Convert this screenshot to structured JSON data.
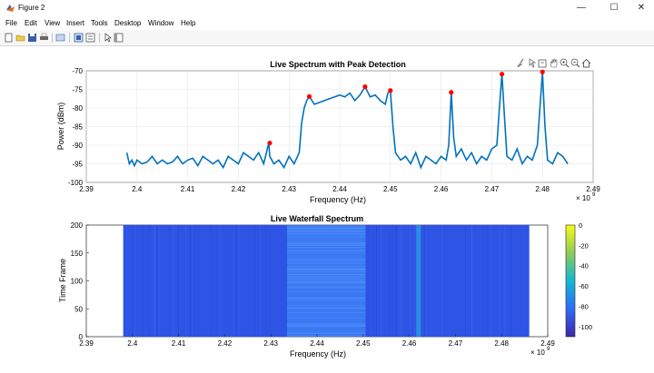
{
  "window": {
    "title": "Figure 2",
    "minimize": "—",
    "maximize": "☐",
    "close": "✕"
  },
  "menu": [
    "File",
    "Edit",
    "View",
    "Insert",
    "Tools",
    "Desktop",
    "Window",
    "Help"
  ],
  "toolbar_icons": [
    "new-figure-icon",
    "open-file-icon",
    "save-icon",
    "print-icon",
    "link-plot-icon",
    "dock-figure-icon",
    "property-inspector-icon",
    "edit-plot-arrow-icon",
    "plot-browser-icon"
  ],
  "axes_toolbar_icons": [
    "brush-icon",
    "data-tips-icon",
    "export-icon",
    "pan-hand-icon",
    "zoom-in-icon",
    "zoom-out-icon",
    "restore-view-icon"
  ],
  "colors": {
    "line": "#0072bd",
    "peak": "#ff0000",
    "grid": "#e6e6e6"
  },
  "chart_data": [
    {
      "type": "line",
      "title": "Live Spectrum with Peak Detection",
      "xlabel": "Frequency (Hz)",
      "ylabel": "Power (dBm)",
      "x_exponent": "× 10",
      "x_exponent_power": "9",
      "xlim": [
        2.39,
        2.49
      ],
      "ylim": [
        -100,
        -70
      ],
      "xticks": [
        "2.39",
        "2.4",
        "2.41",
        "2.42",
        "2.43",
        "2.44",
        "2.45",
        "2.46",
        "2.47",
        "2.48",
        "2.49"
      ],
      "yticks": [
        "-100",
        "-95",
        "-90",
        "-85",
        "-80",
        "-75",
        "-70"
      ],
      "grid": true,
      "series": [
        {
          "x": [
            2.398,
            2.3985,
            2.399,
            2.3995,
            2.4,
            2.401,
            2.402,
            2.403,
            2.404,
            2.405,
            2.406,
            2.407,
            2.408,
            2.409,
            2.41,
            2.411,
            2.412,
            2.413,
            2.414,
            2.415,
            2.416,
            2.417,
            2.418,
            2.419,
            2.42,
            2.421,
            2.422,
            2.423,
            2.424,
            2.425,
            2.426,
            2.4262,
            2.427,
            2.428,
            2.429,
            2.43,
            2.431,
            2.432,
            2.4325,
            2.433,
            2.4335,
            2.434,
            2.435,
            2.436,
            2.437,
            2.438,
            2.439,
            2.44,
            2.441,
            2.442,
            2.443,
            2.444,
            2.445,
            2.446,
            2.447,
            2.448,
            2.449,
            2.4495,
            2.45,
            2.4505,
            2.451,
            2.452,
            2.453,
            2.454,
            2.455,
            2.456,
            2.457,
            2.458,
            2.459,
            2.46,
            2.461,
            2.4615,
            2.462,
            2.4625,
            2.463,
            2.464,
            2.465,
            2.466,
            2.467,
            2.468,
            2.469,
            2.47,
            2.471,
            2.4715,
            2.472,
            2.4725,
            2.473,
            2.474,
            2.475,
            2.476,
            2.477,
            2.478,
            2.479,
            2.4795,
            2.48,
            2.4805,
            2.481,
            2.482,
            2.483,
            2.484,
            2.485
          ],
          "y": [
            -92,
            -95,
            -94,
            -95.5,
            -94,
            -95,
            -94.5,
            -93,
            -95,
            -94,
            -95,
            -94.5,
            -93,
            -95,
            -94,
            -93.5,
            -95.5,
            -93,
            -94,
            -95,
            -94,
            -96,
            -93,
            -94,
            -95,
            -92,
            -93,
            -94,
            -92,
            -95,
            -89.4,
            -93,
            -95,
            -94,
            -96,
            -93,
            -95,
            -92,
            -84,
            -80,
            -78,
            -76.9,
            -79,
            -78.5,
            -78,
            -77.5,
            -77,
            -76.5,
            -77,
            -76,
            -78,
            -76.5,
            -74.3,
            -77,
            -76.5,
            -78,
            -79,
            -76,
            -75.3,
            -85,
            -92,
            -94,
            -93,
            -95,
            -92,
            -96,
            -93,
            -94,
            -95,
            -93,
            -94,
            -90,
            -75.8,
            -88,
            -93,
            -91,
            -94,
            -92,
            -95,
            -93,
            -94,
            -91,
            -90,
            -80,
            -70.9,
            -82,
            -93,
            -94,
            -91,
            -95,
            -93,
            -94,
            -90,
            -80,
            -70.3,
            -85,
            -94,
            -95,
            -92,
            -93,
            -95
          ]
        }
      ],
      "peaks": [
        {
          "x": 2.4262,
          "y": -89.4
        },
        {
          "x": 2.434,
          "y": -76.9
        },
        {
          "x": 2.445,
          "y": -74.3
        },
        {
          "x": 2.45,
          "y": -75.3
        },
        {
          "x": 2.462,
          "y": -75.8
        },
        {
          "x": 2.472,
          "y": -70.9
        },
        {
          "x": 2.48,
          "y": -70.3
        }
      ]
    },
    {
      "type": "heatmap",
      "title": "Live Waterfall Spectrum",
      "xlabel": "Frequency (Hz)",
      "ylabel": "Time Frame",
      "x_exponent": "× 10",
      "x_exponent_power": "9",
      "xlim": [
        2.39,
        2.49
      ],
      "ylim": [
        0,
        200
      ],
      "data_xrange": [
        2.398,
        2.486
      ],
      "xticks": [
        "2.39",
        "2.4",
        "2.41",
        "2.42",
        "2.43",
        "2.44",
        "2.45",
        "2.46",
        "2.47",
        "2.48",
        "2.49"
      ],
      "yticks": [
        "0",
        "50",
        "100",
        "150",
        "200"
      ],
      "colorbar": {
        "ticks": [
          "0",
          "-20",
          "-40",
          "-60",
          "-80",
          "-100"
        ],
        "range": [
          -110,
          0
        ],
        "colormap": "parula"
      },
      "bands": [
        {
          "from": 2.4335,
          "to": 2.4505,
          "level": -78
        },
        {
          "from": 2.4615,
          "to": 2.4625,
          "level": -76
        }
      ],
      "background_level": -94
    }
  ]
}
